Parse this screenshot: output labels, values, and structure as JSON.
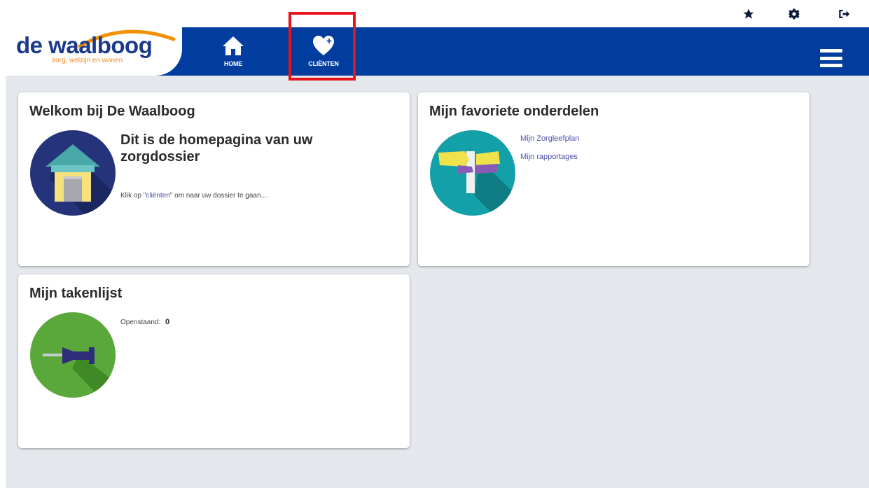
{
  "nav": {
    "logo_name": "de waalboog",
    "logo_tagline": "zorg, welzijn en wonen",
    "items": [
      {
        "label": "HOME",
        "icon": "home-icon"
      },
      {
        "label": "CLIËNTEN",
        "icon": "heart-plus-icon"
      }
    ],
    "top_icons": [
      "star-icon",
      "gear-icon",
      "logout-icon"
    ]
  },
  "cards": {
    "welcome": {
      "title": "Welkom bij De Waalboog",
      "subtitle": "Dit is de homepagina van uw zorgdossier",
      "text_before": "Klik op \"",
      "link_text": "cliënten",
      "text_after": "\" om naar uw dossier te gaan....",
      "icon": "house-icon"
    },
    "favorites": {
      "title": "Mijn favoriete onderdelen",
      "links": [
        "Mijn Zorgleefplan",
        "Mijn rapportages"
      ],
      "icon": "signpost-icon"
    },
    "tasks": {
      "title": "Mijn takenlijst",
      "open_label": "Openstaand:",
      "open_count": "0",
      "icon": "pushpin-icon"
    }
  },
  "colors": {
    "navbar": "#003d9e",
    "highlight": "#e8141b",
    "background": "#e4e8ec",
    "link": "#4d4fa8"
  }
}
